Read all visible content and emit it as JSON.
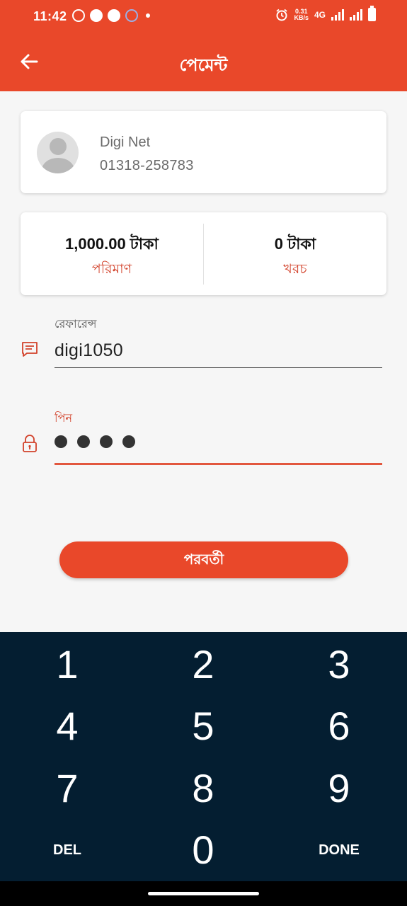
{
  "status_bar": {
    "time": "11:42",
    "speed_value": "0.31",
    "speed_unit": "KB/s",
    "network": "4G",
    "left_icons": [
      "whatsapp-icon",
      "messenger-icon",
      "chat-bubble-icon",
      "vpn-icon",
      "dot-icon"
    ],
    "right_icons": [
      "alarm-icon",
      "signal-icon",
      "signal-icon",
      "battery-icon"
    ]
  },
  "app_bar": {
    "title": "পেমেন্ট",
    "back_icon": "arrow-left-icon"
  },
  "merchant": {
    "name": "Digi Net",
    "phone": "01318-258783"
  },
  "amount": {
    "value": "1,000.00 টাকা",
    "label": "পরিমাণ"
  },
  "charge": {
    "value": "0 টাকা",
    "label": "খরচ"
  },
  "reference": {
    "label": "রেফারেন্স",
    "value": "digi1050"
  },
  "pin": {
    "label": "পিন",
    "digits_entered": 4
  },
  "next_button": {
    "label": "পরবর্তী"
  },
  "keypad": {
    "k1": "1",
    "k2": "2",
    "k3": "3",
    "k4": "4",
    "k5": "5",
    "k6": "6",
    "k7": "7",
    "k8": "8",
    "k9": "9",
    "del": "DEL",
    "k0": "0",
    "done": "DONE"
  },
  "colors": {
    "primary": "#e9482a",
    "label_accent": "#d2412a",
    "keypad_bg": "#041e31"
  }
}
